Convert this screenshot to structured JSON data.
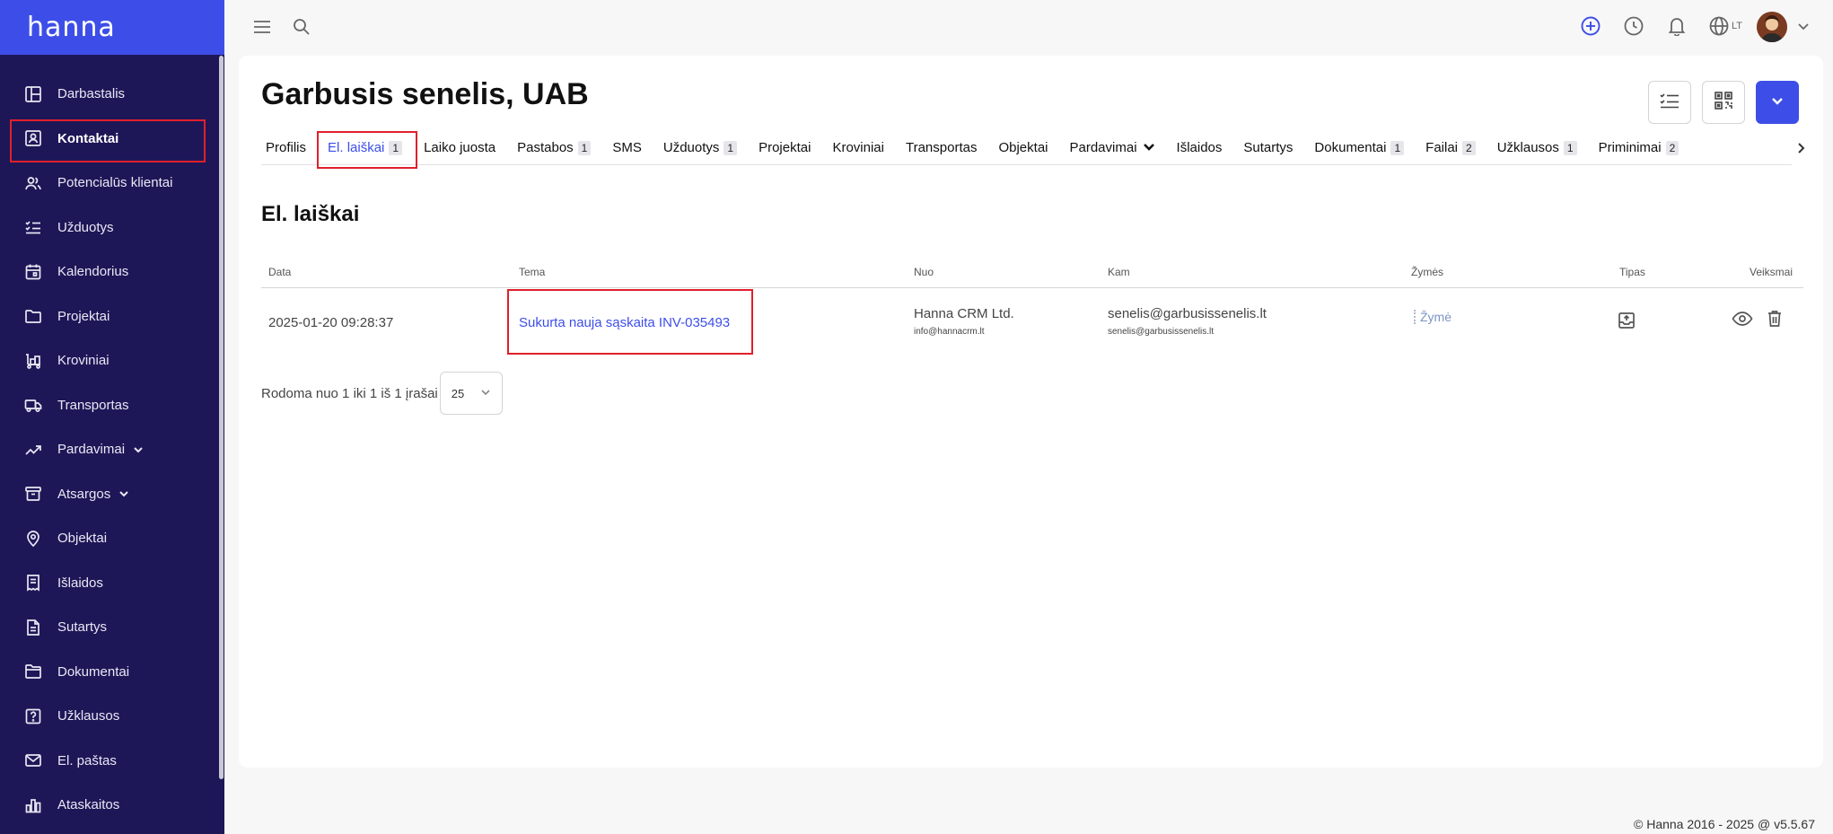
{
  "brand": {
    "name": "hanna"
  },
  "sidebar": {
    "items": [
      {
        "label": "Darbastalis",
        "icon": "dashboard-icon"
      },
      {
        "label": "Kontaktai",
        "icon": "contact-card-icon",
        "active": true
      },
      {
        "label": "Potencialūs klientai",
        "icon": "users-icon"
      },
      {
        "label": "Užduotys",
        "icon": "checklist-icon"
      },
      {
        "label": "Kalendorius",
        "icon": "calendar-icon"
      },
      {
        "label": "Projektai",
        "icon": "folder-icon"
      },
      {
        "label": "Kroviniai",
        "icon": "forklift-icon"
      },
      {
        "label": "Transportas",
        "icon": "truck-icon"
      },
      {
        "label": "Pardavimai",
        "icon": "trend-up-icon",
        "expandable": true
      },
      {
        "label": "Atsargos",
        "icon": "archive-icon",
        "expandable": true
      },
      {
        "label": "Objektai",
        "icon": "map-pin-icon"
      },
      {
        "label": "Išlaidos",
        "icon": "receipt-icon"
      },
      {
        "label": "Sutartys",
        "icon": "document-icon"
      },
      {
        "label": "Dokumentai",
        "icon": "documents-icon"
      },
      {
        "label": "Užklausos",
        "icon": "question-icon"
      },
      {
        "label": "El. paštas",
        "icon": "mail-icon"
      },
      {
        "label": "Ataskaitos",
        "icon": "bar-chart-icon"
      }
    ]
  },
  "topbar": {
    "language": "LT"
  },
  "page": {
    "title": "Garbusis senelis, UAB"
  },
  "tabs": [
    {
      "label": "Profilis",
      "badge": ""
    },
    {
      "label": "El. laiškai",
      "badge": "1",
      "active": true
    },
    {
      "label": "Laiko juosta",
      "badge": ""
    },
    {
      "label": "Pastabos",
      "badge": "1"
    },
    {
      "label": "SMS",
      "badge": ""
    },
    {
      "label": "Užduotys",
      "badge": "1"
    },
    {
      "label": "Projektai",
      "badge": ""
    },
    {
      "label": "Kroviniai",
      "badge": ""
    },
    {
      "label": "Transportas",
      "badge": ""
    },
    {
      "label": "Objektai",
      "badge": ""
    },
    {
      "label": "Pardavimai",
      "badge": "",
      "dropdown": true
    },
    {
      "label": "Išlaidos",
      "badge": ""
    },
    {
      "label": "Sutartys",
      "badge": ""
    },
    {
      "label": "Dokumentai",
      "badge": "1"
    },
    {
      "label": "Failai",
      "badge": "2"
    },
    {
      "label": "Užklausos",
      "badge": "1"
    },
    {
      "label": "Priminimai",
      "badge": "2"
    }
  ],
  "section": {
    "title": "El. laiškai"
  },
  "table": {
    "columns": [
      "Data",
      "Tema",
      "Nuo",
      "Kam",
      "Žymės",
      "Tipas",
      "Veiksmai"
    ],
    "rows": [
      {
        "date": "2025-01-20 09:28:37",
        "subject": "Sukurta nauja sąskaita INV-035493",
        "from_name": "Hanna CRM Ltd.",
        "from_email": "info@hannacrm.lt",
        "to_name": "senelis@garbusissenelis.lt",
        "to_email": "senelis@garbusissenelis.lt",
        "tag": "Žymė"
      }
    ]
  },
  "pager": {
    "text": "Rodoma nuo 1 iki 1 iš 1 įrašai",
    "page_size": "25"
  },
  "footer": {
    "text": "© Hanna 2016 - 2025 @ v5.5.67"
  },
  "colors": {
    "sidebar_bg": "#1e1757",
    "brand_bg": "#3d4ee8",
    "accent": "#3d4ee8",
    "highlight": "#e0202a"
  }
}
